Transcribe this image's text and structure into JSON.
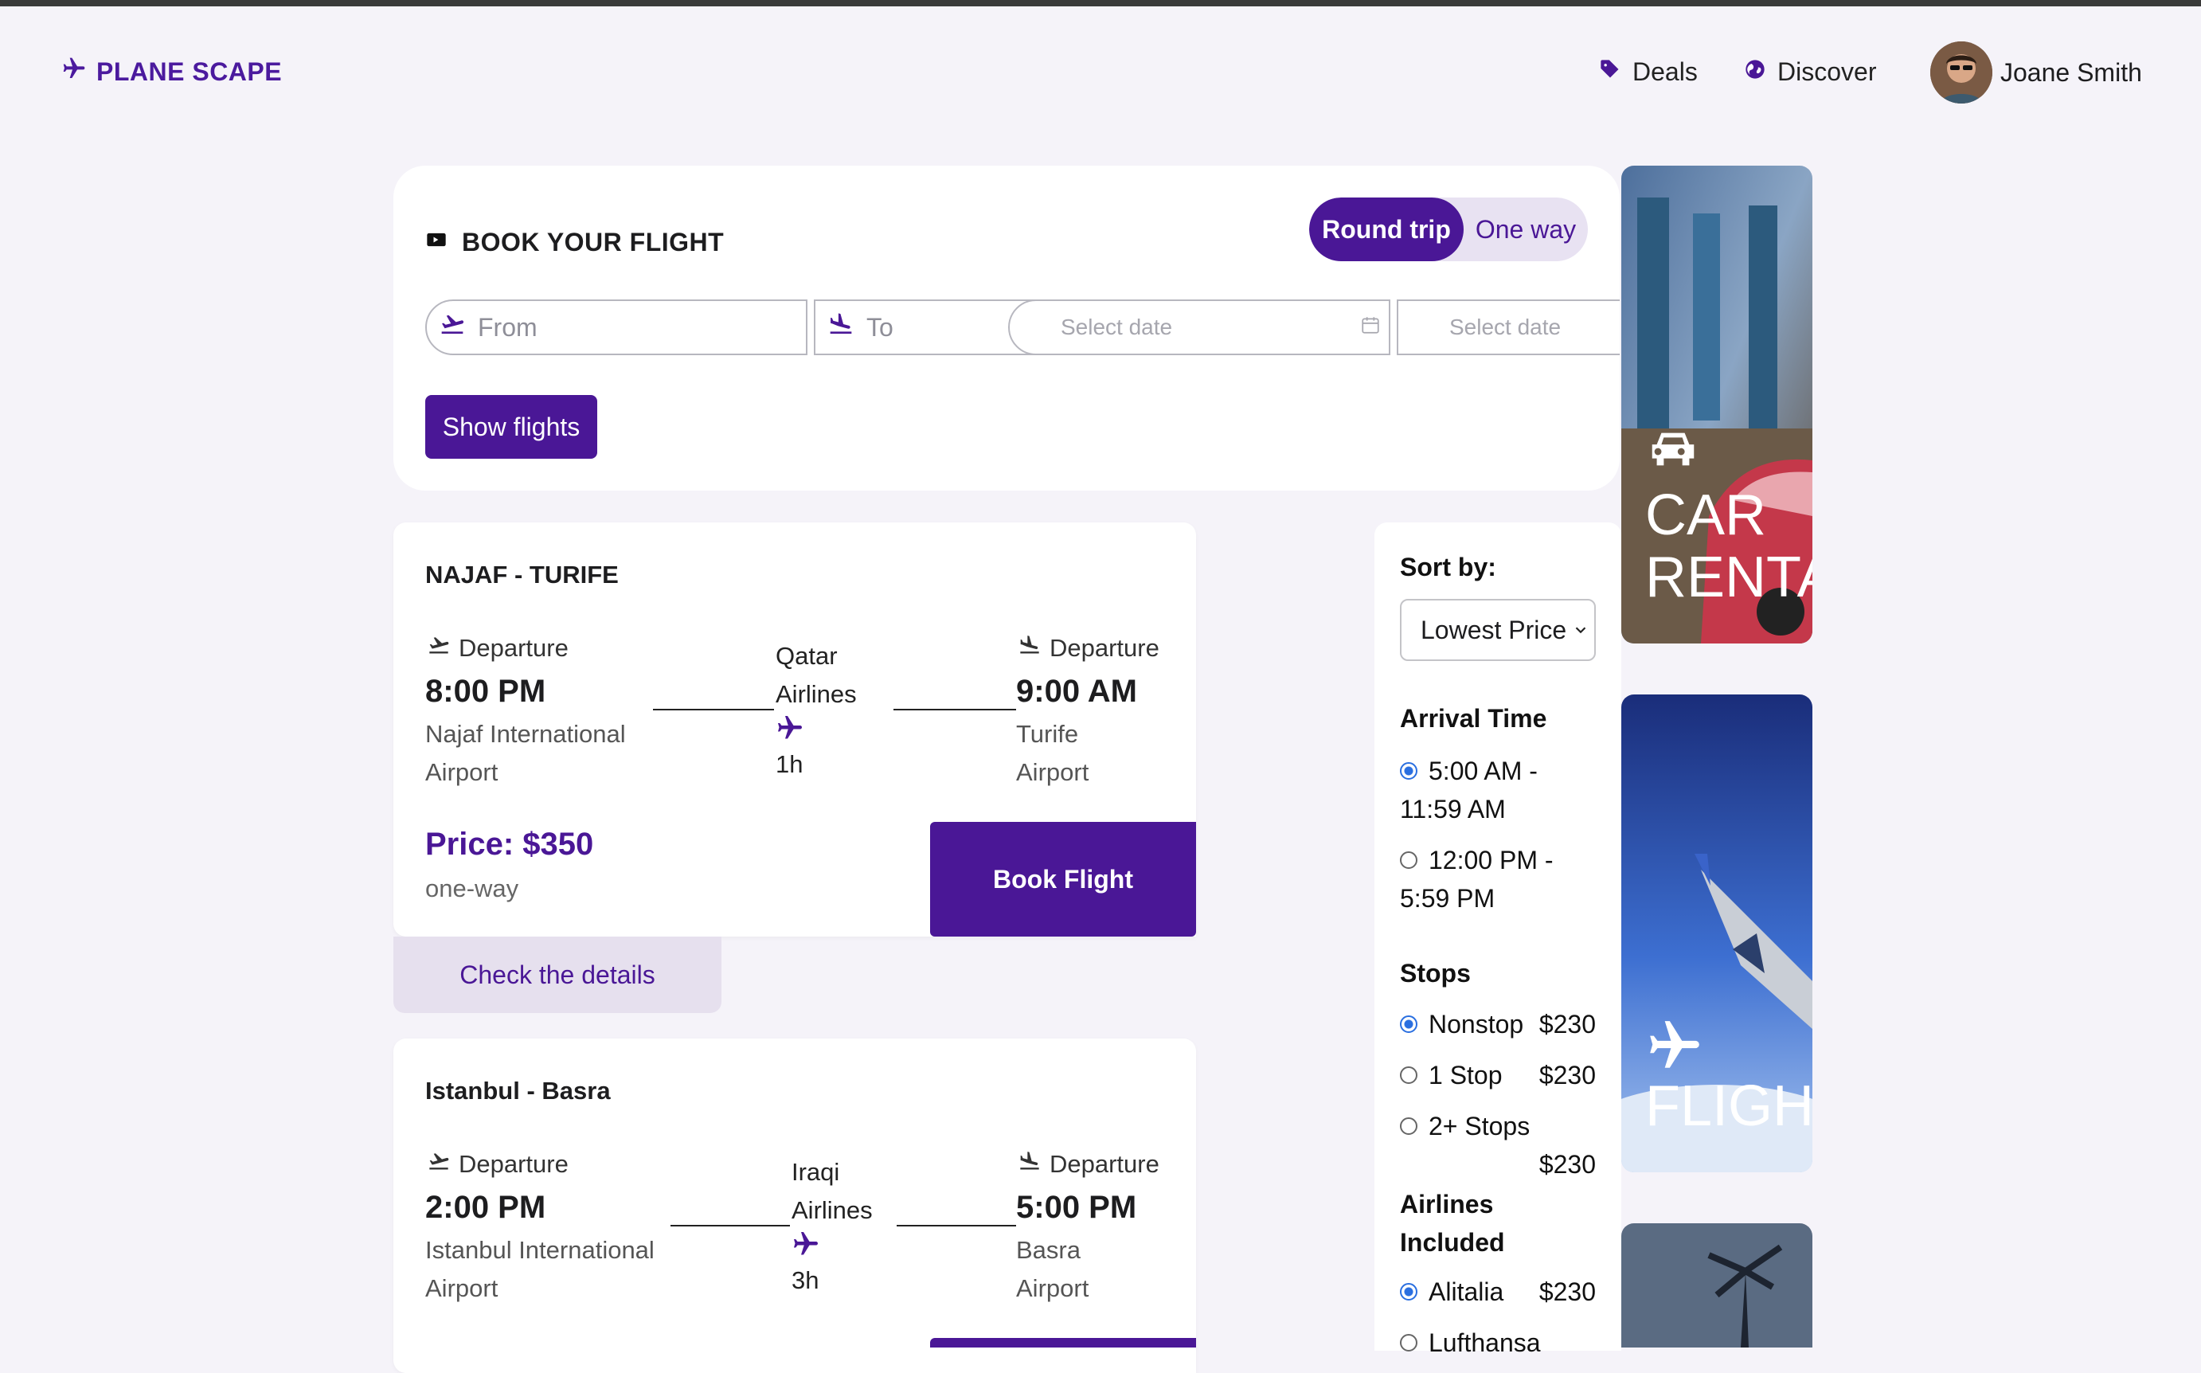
{
  "header": {
    "logo": "PLANE SCAPE",
    "nav": [
      {
        "label": "Deals",
        "icon": "tag-icon"
      },
      {
        "label": "Discover",
        "icon": "globe-icon"
      }
    ],
    "user_name": "Joane Smith"
  },
  "booking": {
    "title": "BOOK YOUR FLIGHT",
    "trip_options": [
      "Round trip",
      "One way"
    ],
    "selected_trip": "Round trip",
    "from_placeholder": "From",
    "to_placeholder": "To",
    "depart_date_placeholder": "Select date",
    "return_date_placeholder": "Select date",
    "show_button": "Show flights"
  },
  "flights": [
    {
      "route": "NAJAF - TURIFE",
      "dep_label": "Departure",
      "dep_time": "8:00 PM",
      "dep_airport_l1": "Najaf International",
      "dep_airport_l2": "Airport",
      "airline_l1": "Qatar",
      "airline_l2": "Airlines",
      "duration": "1h",
      "arr_label": "Departure",
      "arr_time": "9:00 AM",
      "arr_airport_l1": "Turife",
      "arr_airport_l2": "Airport",
      "price": "Price: $350",
      "price_note": "one-way",
      "book_label": "Book Flight",
      "details_label": "Check the details"
    },
    {
      "route": "Istanbul - Basra",
      "dep_label": "Departure",
      "dep_time": "2:00 PM",
      "dep_airport_l1": "Istanbul International",
      "dep_airport_l2": "Airport",
      "airline_l1": "Iraqi",
      "airline_l2": "Airlines",
      "duration": "3h",
      "arr_label": "Departure",
      "arr_time": "5:00 PM",
      "arr_airport_l1": "Basra",
      "arr_airport_l2": "Airport"
    }
  ],
  "filters": {
    "sort_label": "Sort by:",
    "sort_value": "Lowest Price",
    "arrival_title": "Arrival Time",
    "arrival_options": [
      {
        "l1": "5:00 AM -",
        "l2": "11:59 AM",
        "selected": true
      },
      {
        "l1": "12:00 PM -",
        "l2": "5:59 PM",
        "selected": false
      }
    ],
    "stops_title": "Stops",
    "stops": [
      {
        "label": "Nonstop",
        "price": "$230",
        "selected": true
      },
      {
        "label": "1 Stop",
        "price": "$230",
        "selected": false
      },
      {
        "label": "2+ Stops",
        "price": "$230",
        "selected": false
      }
    ],
    "airlines_title_l1": "Airlines",
    "airlines_title_l2": "Included",
    "airlines": [
      {
        "label": "Alitalia",
        "price": "$230",
        "selected": true
      },
      {
        "label": "Lufthansa",
        "price": "",
        "selected": false
      }
    ]
  },
  "side_cards": [
    {
      "l1": "CAR",
      "l2": "RENTALS",
      "icon": "car-icon"
    },
    {
      "l1": "FLIGHTS",
      "icon": "airplane-icon"
    }
  ],
  "colors": {
    "accent": "#4a1796",
    "background": "#f5f3f9"
  }
}
